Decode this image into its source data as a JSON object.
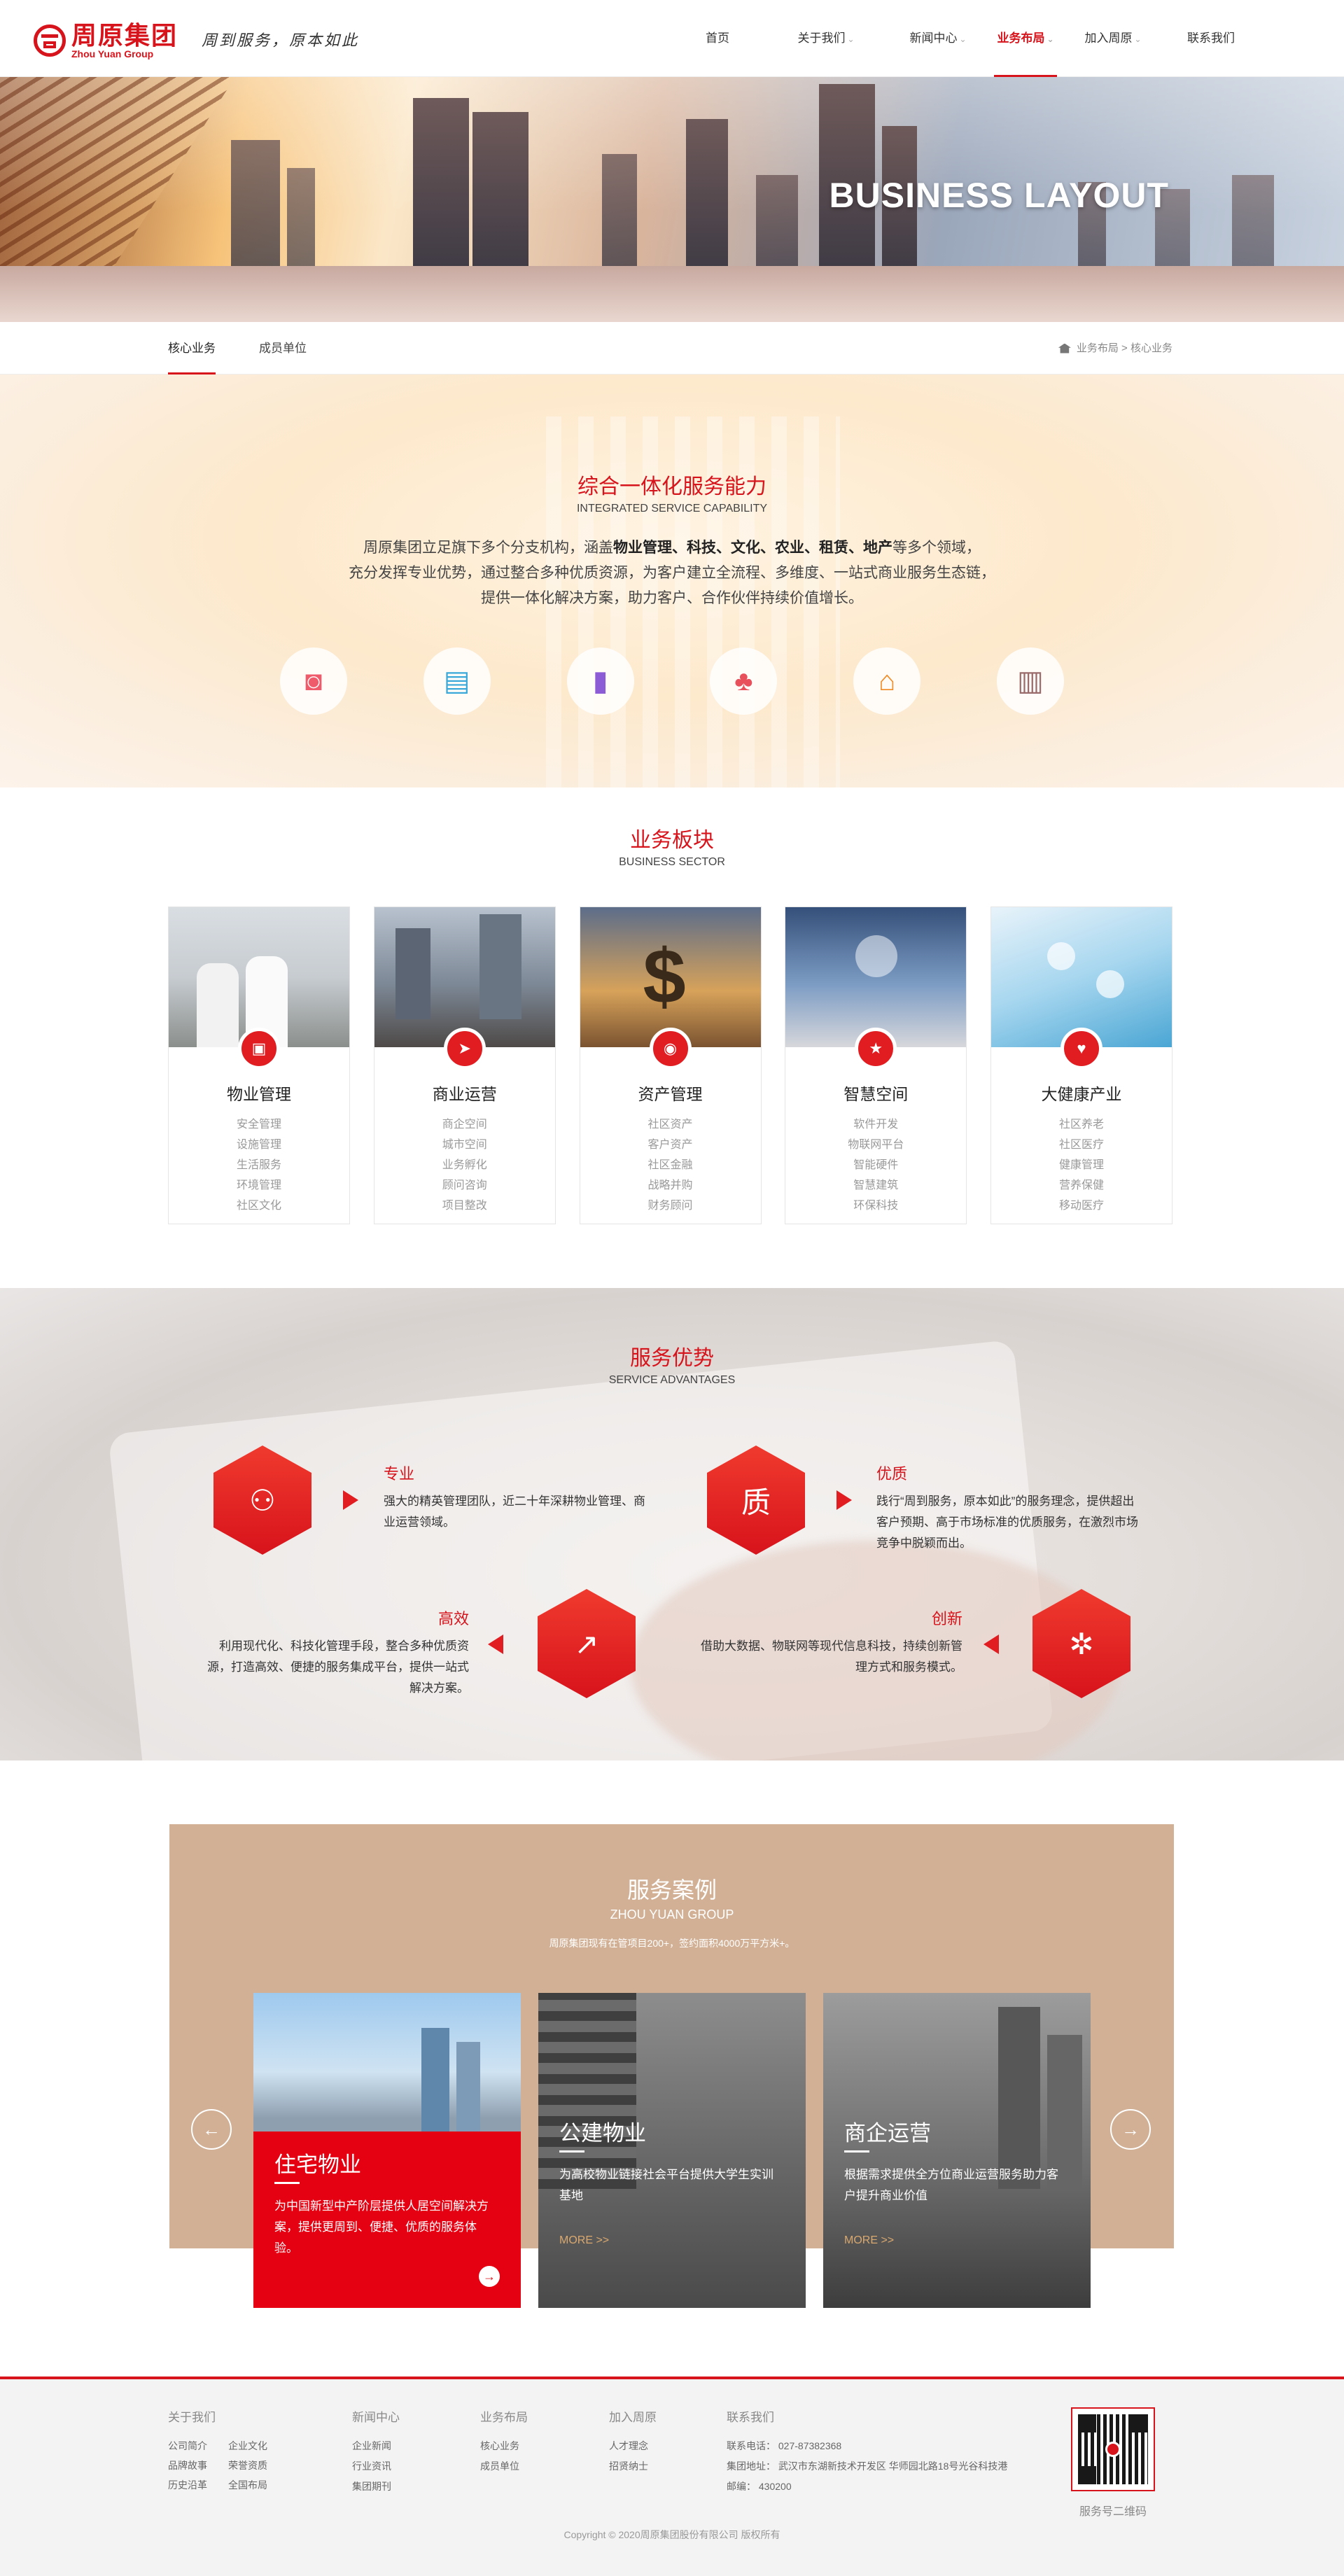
{
  "brand": {
    "name_cn": "周原集团",
    "name_en": "Zhou Yuan Group",
    "slogan": "周到服务，原本如此",
    "color": "#d7131b"
  },
  "nav": {
    "items": [
      {
        "label": "首页"
      },
      {
        "label": "关于我们"
      },
      {
        "label": "新闻中心"
      },
      {
        "label": "业务布局"
      },
      {
        "label": "加入周原"
      },
      {
        "label": "联系我们"
      }
    ],
    "active": "业务布局"
  },
  "banner": {
    "title": "BUSINESS LAYOUT"
  },
  "subnav": {
    "tabs": [
      {
        "label": "核心业务"
      },
      {
        "label": "成员单位"
      }
    ],
    "active": "核心业务",
    "breadcrumb": "业务布局 > 核心业务"
  },
  "integrated": {
    "title_cn": "综合一体化服务能力",
    "title_en": "INTEGRATED SERVICE CAPABILITY",
    "intro_line1_a": "周原集团立足旗下多个分支机构，涵盖",
    "intro_line1_b": "物业管理、科技、文化、农业、租赁、地产",
    "intro_line1_c": "等多个领域，",
    "intro_line2": "充分发挥专业优势，通过整合多种优质资源，为客户建立全流程、多维度、一站式商业服务生态链，",
    "intro_line3": "提供一体化解决方案，助力客户、合作伙伴持续价值增长。",
    "icons": [
      {
        "icon": "robot-icon",
        "glyph": "🤖",
        "color": "#f05b6c"
      },
      {
        "icon": "toolbox-icon",
        "glyph": "🧰",
        "color": "#3aa8d8"
      },
      {
        "icon": "book-icon",
        "glyph": "📘",
        "color": "#8c5bd6"
      },
      {
        "icon": "tree-icon",
        "glyph": "🌲",
        "color": "#e8505b"
      },
      {
        "icon": "house-yuan-icon",
        "glyph": "🏠",
        "color": "#f08a24"
      },
      {
        "icon": "building-icon",
        "glyph": "🏢",
        "color": "#9a6b6b"
      }
    ]
  },
  "sector": {
    "title_cn": "业务板块",
    "title_en": "BUSINESS SECTOR",
    "cards": [
      {
        "name": "物业管理",
        "icon": "property-icon",
        "glyph": "▣",
        "items": [
          "安全管理",
          "设施管理",
          "生活服务",
          "环境管理",
          "社区文化"
        ]
      },
      {
        "name": "商业运营",
        "icon": "paper-plane-icon",
        "glyph": "➤",
        "items": [
          "商企空间",
          "城市空间",
          "业务孵化",
          "顾问咨询",
          "项目整改"
        ]
      },
      {
        "name": "资产管理",
        "icon": "target-icon",
        "glyph": "◉",
        "items": [
          "社区资产",
          "客户资产",
          "社区金融",
          "战略并购",
          "财务顾问"
        ]
      },
      {
        "name": "智慧空间",
        "icon": "star-icon",
        "glyph": "★",
        "items": [
          "软件开发",
          "物联网平台",
          "智能硬件",
          "智慧建筑",
          "环保科技"
        ]
      },
      {
        "name": "大健康产业",
        "icon": "heart-pulse-icon",
        "glyph": "♥",
        "items": [
          "社区养老",
          "社区医疗",
          "健康管理",
          "营养保健",
          "移动医疗"
        ]
      }
    ]
  },
  "advantages": {
    "title_cn": "服务优势",
    "title_en": "SERVICE ADVANTAGES",
    "items": [
      {
        "title": "专业",
        "icon": "team-icon",
        "desc": "强大的精英管理团队，近二十年深耕物业管理、商业运营领域。"
      },
      {
        "title": "优质",
        "icon": "quality-icon",
        "desc": "践行“周到服务，原本如此”的服务理念，提供超出客户预期、高于市场标准的优质服务，在激烈市场竞争中脱颖而出。"
      },
      {
        "title": "高效",
        "icon": "chart-icon",
        "desc": "利用现代化、科技化管理手段，整合多种优质资源，打造高效、便捷的服务集成平台，提供一站式解决方案。"
      },
      {
        "title": "创新",
        "icon": "network-icon",
        "desc": "借助大数据、物联网等现代信息科技，持续创新管理方式和服务模式。"
      }
    ]
  },
  "cases": {
    "title_cn": "服务案例",
    "title_en": "ZHOU YUAN GROUP",
    "desc": "周原集团现有在管项目200+，签约面积4000万平方米+。",
    "items": [
      {
        "label": "住宅物业",
        "desc": "为中国新型中产阶层提供人居空间解决方案，提供更周到、便捷、优质的服务体验。"
      },
      {
        "label": "公建物业",
        "desc": "为高校物业链接社会平台提供大学生实训基地",
        "more": "MORE >>"
      },
      {
        "label": "商企运营",
        "desc": "根据需求提供全方位商业运营服务助力客户提升商业价值",
        "more": "MORE >>"
      }
    ]
  },
  "footer": {
    "about": {
      "title": "关于我们",
      "links": [
        "公司简介",
        "企业文化",
        "品牌故事",
        "荣誉资质",
        "历史沿革",
        "全国布局"
      ]
    },
    "news": {
      "title": "新闻中心",
      "links": [
        "企业新闻",
        "行业资讯",
        "集团期刊"
      ]
    },
    "business": {
      "title": "业务布局",
      "links": [
        "核心业务",
        "成员单位"
      ]
    },
    "join": {
      "title": "加入周原",
      "links": [
        "人才理念",
        "招贤纳士"
      ]
    },
    "contact": {
      "title": "联系我们",
      "phone": "联系电话： 027-87382368",
      "address": "集团地址： 武汉市东湖新技术开发区 华师园北路18号光谷科技港",
      "postcode": "邮编： 430200"
    },
    "qr_label": "服务号二维码",
    "copyright": "Copyright © 2020周原集团股份有限公司 版权所有"
  }
}
